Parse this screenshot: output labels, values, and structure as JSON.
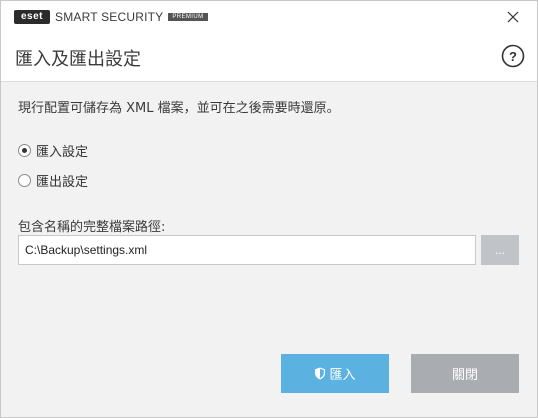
{
  "window": {
    "brand_logo": "eset",
    "product_name": "SMART SECURITY",
    "edition_badge": "PREMIUM",
    "close_icon": "close-icon"
  },
  "header": {
    "title": "匯入及匯出設定",
    "help_icon": "help-icon"
  },
  "main": {
    "description": "現行配置可儲存為 XML 檔案，並可在之後需要時還原。",
    "options": [
      {
        "label": "匯入設定",
        "checked": true
      },
      {
        "label": "匯出設定",
        "checked": false
      }
    ],
    "path_label": "包含名稱的完整檔案路徑:",
    "path_value": "C:\\Backup\\settings.xml",
    "browse_label": "..."
  },
  "footer": {
    "import_label": "匯入",
    "import_icon": "shield-icon",
    "close_label": "關閉"
  },
  "colors": {
    "primary_button": "#5bb1e0",
    "secondary_button": "#a9adb1",
    "browse_button": "#c0c4c8"
  }
}
